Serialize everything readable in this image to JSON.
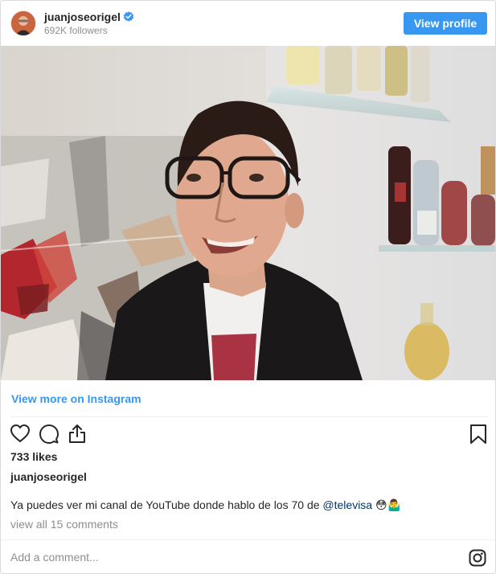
{
  "header": {
    "username": "juanjoseorigel",
    "followers": "692K followers",
    "view_profile_label": "View profile",
    "verified_icon": "verified-badge-icon",
    "avatar_icon": "profile-avatar"
  },
  "post": {
    "view_more_label": "View more on Instagram",
    "likes": "733 likes",
    "caption_user": "juanjoseorigel",
    "caption_text": "Ya puedes ver mi canal de YouTube donde hablo de los 70 de ",
    "caption_mention": "@televisa",
    "caption_emoji": "😳🤷‍♂️",
    "view_comments": "view all 15 comments",
    "add_comment_placeholder": "Add a comment..."
  },
  "icons": {
    "like": "heart-icon",
    "comment": "comment-bubble-icon",
    "share": "share-icon",
    "save": "bookmark-icon",
    "brand": "instagram-icon"
  },
  "colors": {
    "accent": "#3897f0",
    "mention": "#003569",
    "muted": "#8e8e8e",
    "text": "#262626",
    "border": "#dbdbdb"
  }
}
